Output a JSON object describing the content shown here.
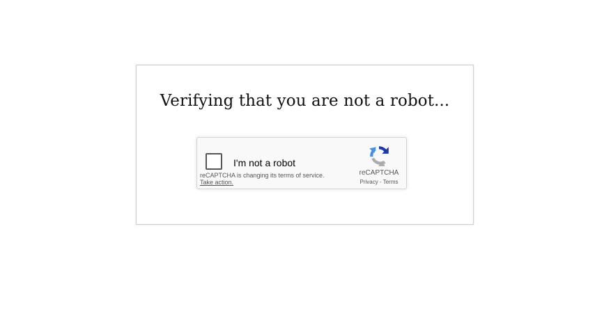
{
  "page": {
    "heading": "Verifying that you are not a robot..."
  },
  "recaptcha": {
    "checkbox_label": "I'm not a robot",
    "notice_text": "reCAPTCHA is changing its terms of service.",
    "take_action_link": "Take action.",
    "brand_name": "reCAPTCHA",
    "privacy_link": "Privacy",
    "separator": "-",
    "terms_link": "Terms",
    "logo_icon": "recaptcha-logo-icon",
    "colors": {
      "logo_blue": "#1c3aa9",
      "logo_light_blue": "#4a90e2",
      "logo_gray": "#abababab",
      "checkbox_border": "#555555",
      "widget_background": "#f9f9f9"
    }
  }
}
